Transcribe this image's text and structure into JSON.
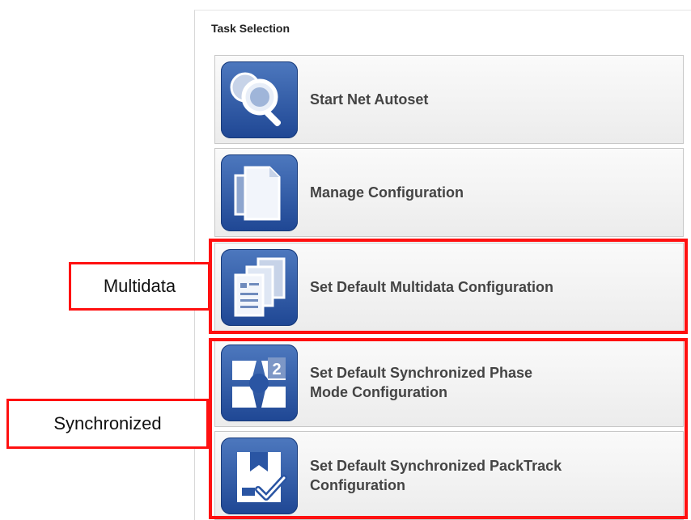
{
  "panel": {
    "title": "Task Selection"
  },
  "tasks": [
    {
      "icon": "magnifier-search-icon",
      "label_lines": [
        "Start Net Autoset"
      ]
    },
    {
      "icon": "documents-copy-icon",
      "label_lines": [
        "Manage Configuration"
      ]
    },
    {
      "icon": "stacked-documents-icon",
      "label_lines": [
        "Set Default Multidata Configuration"
      ]
    },
    {
      "icon": "synchronized-phase-icon",
      "label_lines": [
        "Set Default Synchronized Phase",
        "Mode Configuration"
      ]
    },
    {
      "icon": "packtrack-box-check-icon",
      "label_lines": [
        "Set Default Synchronized PackTrack",
        "Configuration"
      ]
    }
  ],
  "annotations": {
    "multidata": "Multidata",
    "synchronized": "Synchronized",
    "highlight_color": "#ff1010"
  }
}
